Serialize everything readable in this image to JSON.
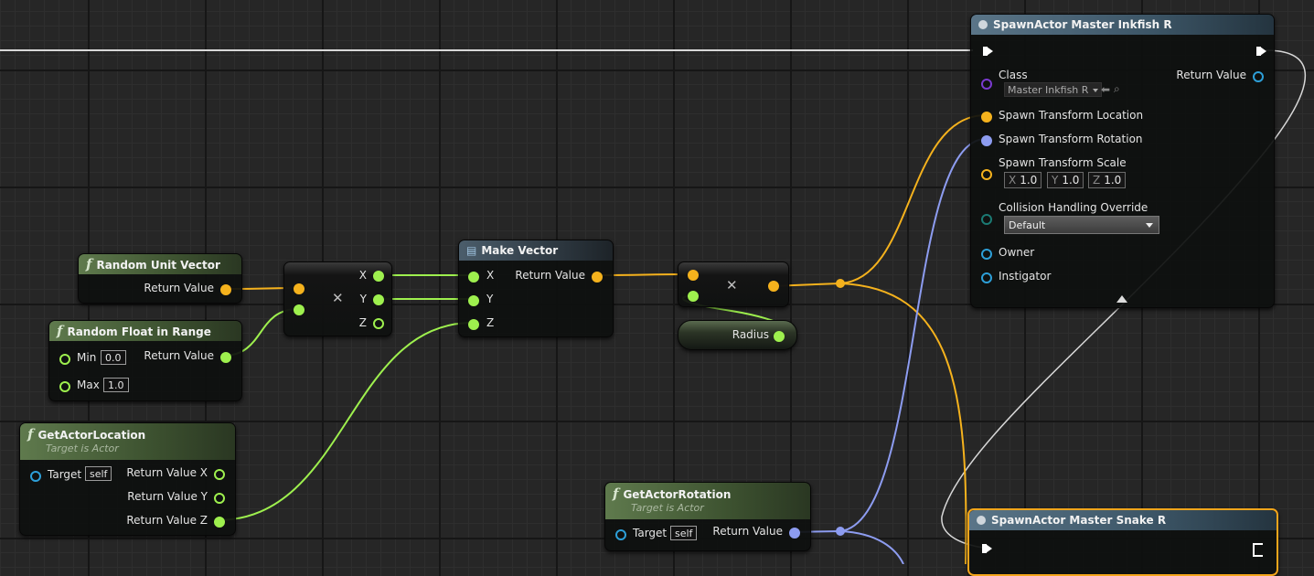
{
  "graph": {
    "nodes": {
      "random_unit_vector": {
        "title": "Random Unit Vector",
        "return_label": "Return Value"
      },
      "random_float": {
        "title": "Random Float in Range",
        "min_label": "Min",
        "min_value": "0.0",
        "max_label": "Max",
        "max_value": "1.0",
        "return_label": "Return Value"
      },
      "get_actor_location": {
        "title": "GetActorLocation",
        "subtitle": "Target is Actor",
        "target_label": "Target",
        "target_value": "self",
        "x_label": "Return Value X",
        "y_label": "Return Value Y",
        "z_label": "Return Value Z"
      },
      "multiply1": {
        "x_label": "X",
        "y_label": "Y",
        "z_label": "Z"
      },
      "make_vector": {
        "title": "Make Vector",
        "x_label": "X",
        "y_label": "Y",
        "z_label": "Z",
        "return_label": "Return Value"
      },
      "radius": {
        "label": "Radius"
      },
      "get_actor_rotation": {
        "title": "GetActorRotation",
        "subtitle": "Target is Actor",
        "target_label": "Target",
        "target_value": "self",
        "return_label": "Return Value"
      },
      "spawn_inkfish": {
        "title": "SpawnActor Master Inkfish R",
        "class_label": "Class",
        "class_value": "Master Inkfish R",
        "return_label": "Return Value",
        "location_label": "Spawn Transform Location",
        "rotation_label": "Spawn Transform Rotation",
        "scale_label": "Spawn Transform Scale",
        "scale": {
          "x_axis": "X",
          "x": "1.0",
          "y_axis": "Y",
          "y": "1.0",
          "z_axis": "Z",
          "z": "1.0"
        },
        "collision_label": "Collision Handling Override",
        "collision_value": "Default",
        "owner_label": "Owner",
        "instigator_label": "Instigator"
      },
      "spawn_snake": {
        "title": "SpawnActor Master Snake R"
      }
    },
    "colors": {
      "float": "#9ef04e",
      "vector": "#f5b21d",
      "rotator": "#8d9cf0",
      "object": "#2d9fd8",
      "class": "#7a3ad0",
      "exec": "#ffffff",
      "selection": "#f3a51b"
    }
  }
}
